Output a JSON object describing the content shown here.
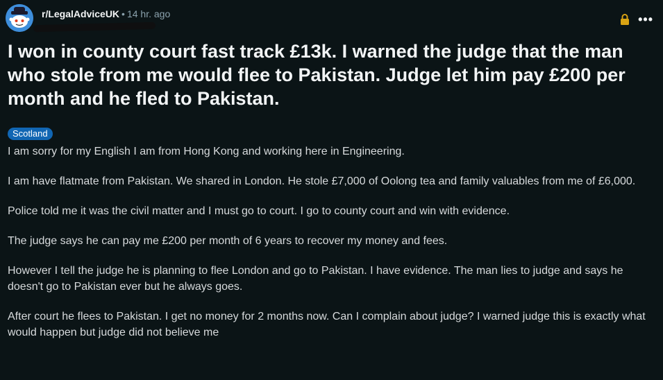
{
  "post": {
    "subreddit": "r/LegalAdviceUK",
    "separator": "•",
    "time_ago": "14 hr. ago",
    "more_label": "•••",
    "title": "I won in county court fast track £13k. I warned the judge that the man who stole from me would flee to Pakistan. Judge let him pay £200 per month and he fled to Pakistan.",
    "flair": "Scotland",
    "paragraphs": [
      "I am sorry for my English I am from Hong Kong and working here in Engineering.",
      "I am have flatmate from Pakistan. We shared in London. He stole £7,000 of Oolong tea and family valuables from me of £6,000.",
      "Police told me it was the civil matter and I must go to court. I go to county court and win with evidence.",
      "The judge says he can pay me £200 per month of 6 years to recover my money and fees.",
      "However I tell the judge he is planning to flee London and go to Pakistan. I have evidence. The man lies to judge and says he doesn't go to Pakistan ever but he always goes.",
      "After court he flees to Pakistan. I get no money for 2 months now. Can I complain about judge? I warned judge this is exactly what would happen but judge did not believe me"
    ]
  },
  "icons": {
    "avatar": "subreddit-avatar",
    "lock": "lock-icon",
    "more": "more-options-icon"
  },
  "colors": {
    "background": "#0b1416",
    "flair_bg": "#1166b3",
    "lock": "#d9a313",
    "meta_text": "#8ba2ad"
  }
}
